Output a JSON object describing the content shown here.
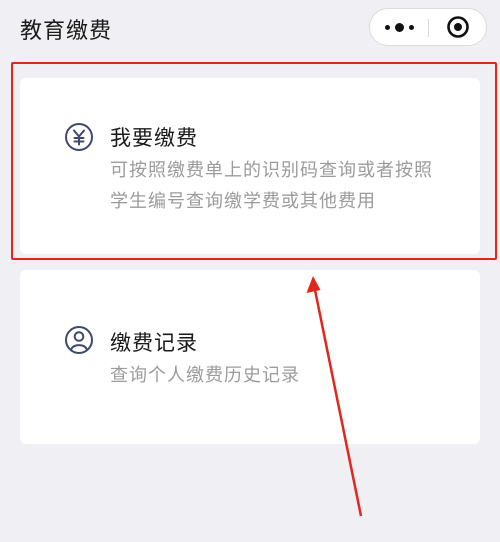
{
  "header": {
    "title": "教育缴费",
    "more_icon": "more-dots-icon",
    "close_icon": "target-close-icon"
  },
  "cards": [
    {
      "icon": "yuan-icon",
      "title": "我要缴费",
      "description": "可按照缴费单上的识别码查询或者按照学生编号查询缴学费或其他费用"
    },
    {
      "icon": "user-icon",
      "title": "缴费记录",
      "description": "查询个人缴费历史记录"
    }
  ],
  "annotation": {
    "highlight_color": "#e0261d"
  }
}
